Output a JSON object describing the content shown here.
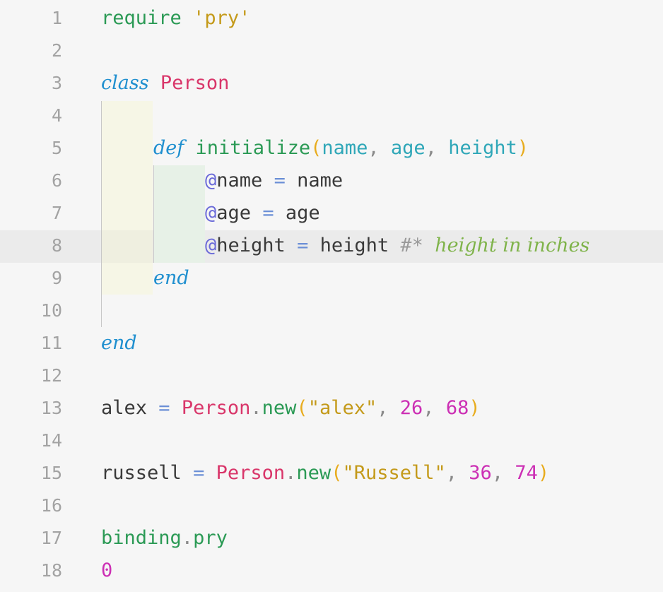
{
  "line_numbers": [
    "1",
    "2",
    "3",
    "4",
    "5",
    "6",
    "7",
    "8",
    "9",
    "10",
    "11",
    "12",
    "13",
    "14",
    "15",
    "16",
    "17",
    "18"
  ],
  "tokens": {
    "l1_require": "require",
    "l1_str": "'pry'",
    "l3_class": "class",
    "l3_name": "Person",
    "l5_def": "def",
    "l5_fn": "initialize",
    "l5_lp": "(",
    "l5_p1": "name",
    "l5_c1": ",",
    "l5_p2": "age",
    "l5_c2": ",",
    "l5_p3": "height",
    "l5_rp": ")",
    "l6_at": "@",
    "l6_var": "name",
    "l6_eq": "=",
    "l6_val": "name",
    "l7_at": "@",
    "l7_var": "age",
    "l7_eq": "=",
    "l7_val": "age",
    "l8_at": "@",
    "l8_var": "height",
    "l8_eq": "=",
    "l8_val": "height",
    "l8_cmark": "#*",
    "l8_comment": "height in inches",
    "l9_end": "end",
    "l11_end": "end",
    "l13_var": "alex",
    "l13_eq": "=",
    "l13_cls": "Person",
    "l13_dot": ".",
    "l13_new": "new",
    "l13_lp": "(",
    "l13_str": "\"alex\"",
    "l13_c1": ",",
    "l13_n1": "26",
    "l13_c2": ",",
    "l13_n2": "68",
    "l13_rp": ")",
    "l15_var": "russell",
    "l15_eq": "=",
    "l15_cls": "Person",
    "l15_dot": ".",
    "l15_new": "new",
    "l15_lp": "(",
    "l15_str": "\"Russell\"",
    "l15_c1": ",",
    "l15_n1": "36",
    "l15_c2": ",",
    "l15_n2": "74",
    "l15_rp": ")",
    "l17_obj": "binding",
    "l17_dot": ".",
    "l17_meth": "pry",
    "l18_num": "0"
  },
  "colors": {
    "background": "#f6f6f6",
    "keyword": "#1f8fcf",
    "class_name": "#d9366a",
    "function": "#2b9a55",
    "parameter": "#2fa7b8",
    "string": "#c49a1a",
    "number": "#cc2fb4",
    "comment": "#7fb34a"
  }
}
